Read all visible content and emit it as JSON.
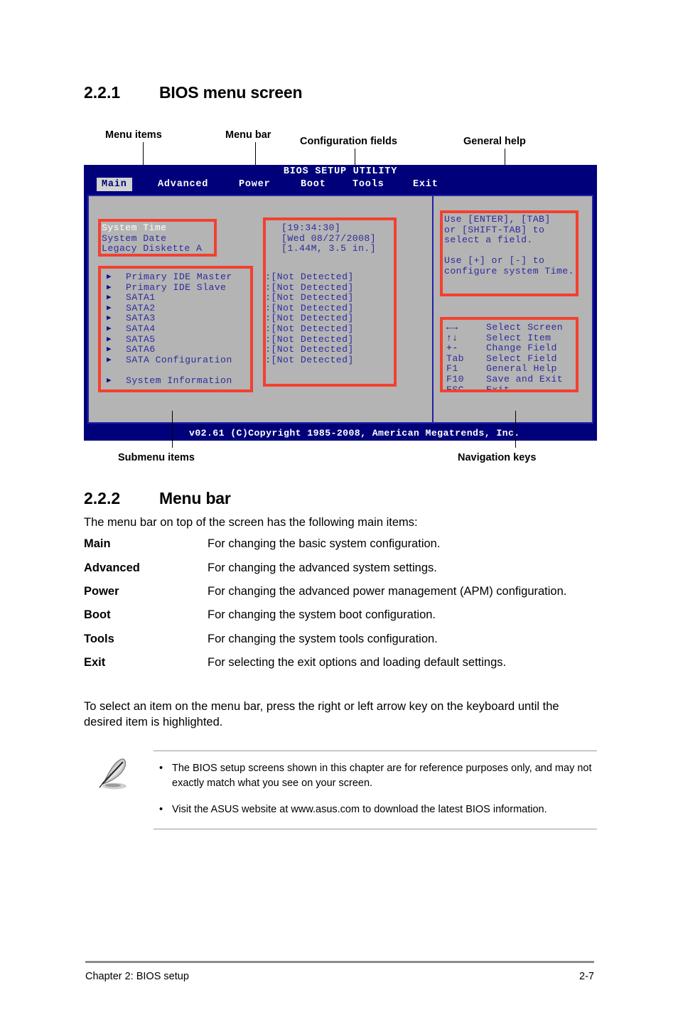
{
  "section_1": {
    "number": "2.2.1",
    "title": "BIOS menu screen"
  },
  "callouts": {
    "menu_items": "Menu items",
    "menu_bar": "Menu bar",
    "configuration_fields": "Configuration fields",
    "general_help": "General help",
    "submenu_items": "Submenu items",
    "navigation_keys": "Navigation keys"
  },
  "bios": {
    "title": "BIOS SETUP UTILITY",
    "tabs": [
      {
        "label": "Main",
        "active": true
      },
      {
        "label": "Advanced",
        "active": false
      },
      {
        "label": "Power",
        "active": false
      },
      {
        "label": "Boot",
        "active": false
      },
      {
        "label": "Tools",
        "active": false
      },
      {
        "label": "Exit",
        "active": false
      }
    ],
    "menu_items": [
      {
        "label": "System Time",
        "value": "[19:34:30]",
        "highlighted": true
      },
      {
        "label": "System Date",
        "value": "[Wed 08/27/2008]",
        "highlighted": false
      },
      {
        "label": "Legacy Diskette A",
        "value": "[1.44M, 3.5 in.]",
        "highlighted": false
      }
    ],
    "submenu_items": [
      {
        "label": "Primary IDE Master",
        "value": ":[Not Detected]"
      },
      {
        "label": "Primary IDE Slave",
        "value": ":[Not Detected]"
      },
      {
        "label": "SATA1",
        "value": ":[Not Detected]"
      },
      {
        "label": "SATA2",
        "value": ":[Not Detected]"
      },
      {
        "label": "SATA3",
        "value": ":[Not Detected]"
      },
      {
        "label": "SATA4",
        "value": ":[Not Detected]"
      },
      {
        "label": "SATA5",
        "value": ":[Not Detected]"
      },
      {
        "label": "SATA6",
        "value": ":[Not Detected]"
      },
      {
        "label": "SATA Configuration",
        "value": ":[Not Detected]"
      },
      {
        "label": "System Information",
        "value": ""
      }
    ],
    "help_lines": [
      "Use [ENTER], [TAB]",
      "or [SHIFT-TAB] to",
      "select a field.",
      "",
      "Use [+] or [-] to",
      "configure system Time."
    ],
    "nav_keys": [
      {
        "key": "←→",
        "action": "Select Screen"
      },
      {
        "key": "↑↓",
        "action": "Select Item"
      },
      {
        "key": "+-",
        "action": "Change Field"
      },
      {
        "key": "Tab",
        "action": "Select Field"
      },
      {
        "key": "F1",
        "action": "General Help"
      },
      {
        "key": "F10",
        "action": "Save and Exit"
      },
      {
        "key": "ESC",
        "action": "Exit"
      }
    ],
    "copyright": "v02.61 (C)Copyright 1985-2008, American Megatrends, Inc.",
    "colors": {
      "chrome_blue": "#00007a",
      "panel_gray": "#b4b4b4",
      "text_blue": "#2c2c9e",
      "highlight_white": "#ffffff",
      "annotation_red": "#f4402e"
    }
  },
  "section_2": {
    "number": "2.2.2",
    "title": "Menu bar",
    "intro": "The menu bar on top of the screen has the following main items:",
    "entries": [
      {
        "term": "Main",
        "desc": "For changing the basic system configuration."
      },
      {
        "term": "Advanced",
        "desc": "For changing the advanced system settings."
      },
      {
        "term": "Power",
        "desc": "For changing the advanced power management (APM) configuration."
      },
      {
        "term": "Boot",
        "desc": "For changing the system boot configuration."
      },
      {
        "term": "Tools",
        "desc": "For changing the system tools configuration."
      },
      {
        "term": "Exit",
        "desc": "For selecting the exit options and loading default settings."
      }
    ],
    "outro_line1": "To select an item on the menu bar, press the right or left arrow key on the keyboard until the",
    "outro_line2": "desired item is highlighted."
  },
  "note": {
    "bullet": "•",
    "items": [
      "The BIOS setup screens shown in this chapter are for reference purposes only, and may not exactly match what you see on your screen.",
      "Visit the ASUS website at www.asus.com to download the latest BIOS information."
    ]
  },
  "page_footer": {
    "left": "Chapter 2: BIOS setup",
    "right": "2-7"
  }
}
